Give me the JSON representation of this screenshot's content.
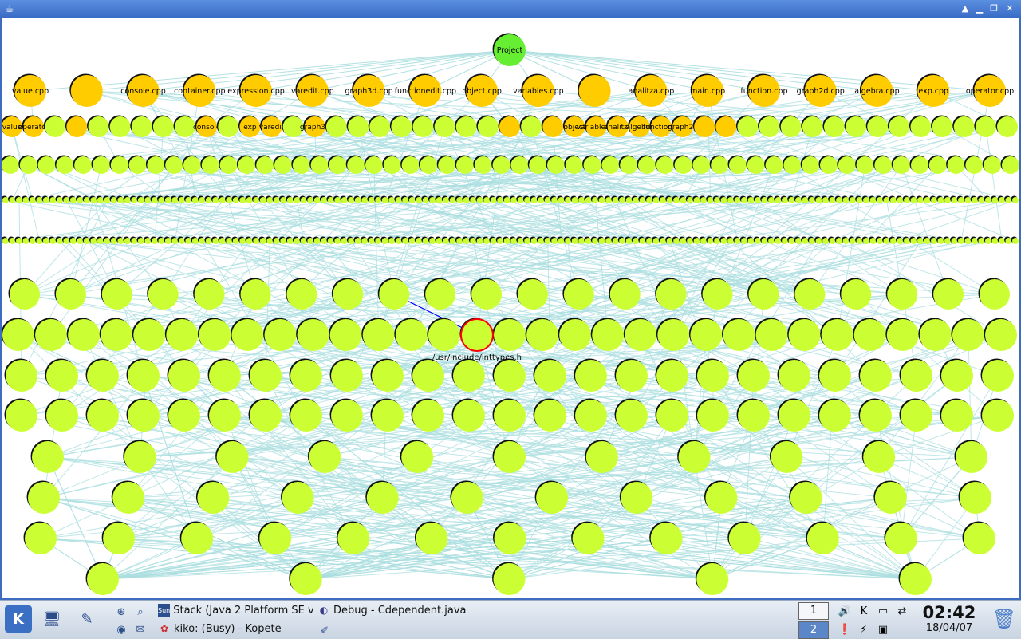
{
  "graph": {
    "root_label": "Project",
    "level1_labels": [
      "value.cpp",
      "",
      "console.cpp",
      "container.cpp",
      "expression.cpp",
      "varedit.cpp",
      "graph3d.cpp",
      "functionedit.cpp",
      "object.cpp",
      "variables.cpp",
      "",
      "analitza.cpp",
      "main.cpp",
      "function.cpp",
      "graph2d.cpp",
      "algebra.cpp",
      "exp.cpp",
      "operator.cpp"
    ],
    "level2_labels": [
      "value",
      "operator",
      "",
      "",
      "",
      "",
      "",
      "",
      "",
      "console",
      "",
      "exp",
      "varedit",
      "",
      "graph3d",
      "",
      "",
      "",
      "",
      "",
      "",
      "",
      "",
      "",
      "",
      "",
      "object",
      "variables.h",
      "analitza",
      "algebra",
      "function.h",
      "graph2d"
    ],
    "selected_label": "/usr/include/inttypes.h",
    "colors": {
      "root": "#66ee33",
      "source": "#ffcc00",
      "header": "#ccff33",
      "edge": "#aadedf",
      "selected": "#ff0000",
      "highlight_edge": "#0000ff"
    }
  },
  "taskbar": {
    "tasks": [
      "Stack (Java 2 Platform SE v",
      "Debug - Cdependent.java",
      "kiko: (Busy) - Kopete"
    ],
    "pager": [
      "1",
      "2"
    ],
    "time": "02:42",
    "date": "18/04/07"
  }
}
